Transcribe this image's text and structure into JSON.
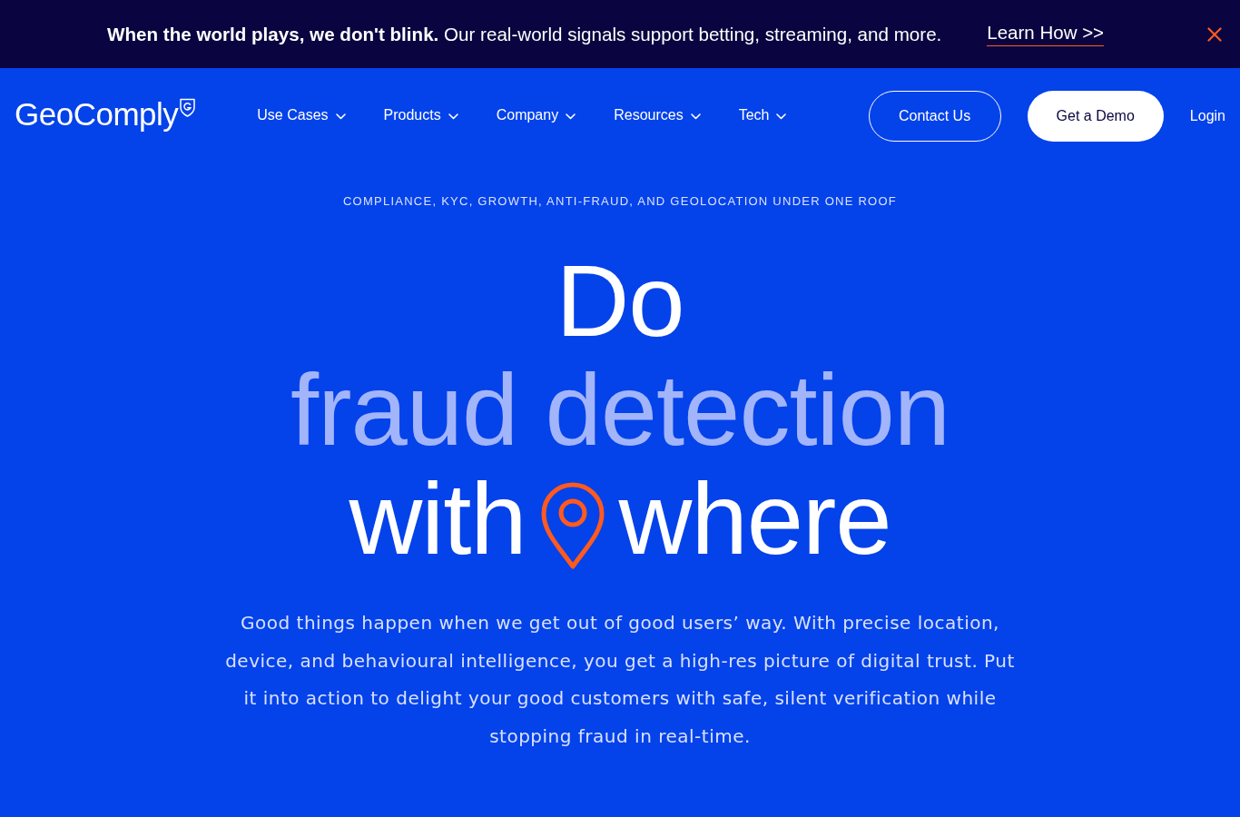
{
  "banner": {
    "message": "**When the world plays, we don't blink.** Our real-world signals support betting, streaming, and more.",
    "link": "Learn How >>"
  },
  "nav": {
    "logo": "GeoComply",
    "items": [
      {
        "label": "Use Cases",
        "dropdown": true
      },
      {
        "label": "Products",
        "dropdown": true
      },
      {
        "label": "Company",
        "dropdown": true
      },
      {
        "label": "Resources",
        "dropdown": true
      },
      {
        "label": "Tech",
        "dropdown": true
      }
    ],
    "actions": [
      {
        "label": "Contact Us",
        "kind": "outline"
      },
      {
        "label": "Get a Demo",
        "kind": "solid"
      },
      {
        "label": "Login",
        "kind": "link"
      }
    ]
  },
  "hero": {
    "eyebrow": "COMPLIANCE, KYC, GROWTH, ANTI-FRAUD, AND GEOLOCATION UNDER ONE ROOF",
    "headline": {
      "line_1": "Do",
      "line_2": "fraud detection",
      "line_3_start": "with",
      "line_3_end": "where"
    },
    "body": "Good things happen when we get out of good users’ way. With precise location, device, and behavioural intelligence, you get a high-res picture of digital trust. Put it into action to delight your good customers with safe, silent verification while stopping fraud in real-time."
  }
}
